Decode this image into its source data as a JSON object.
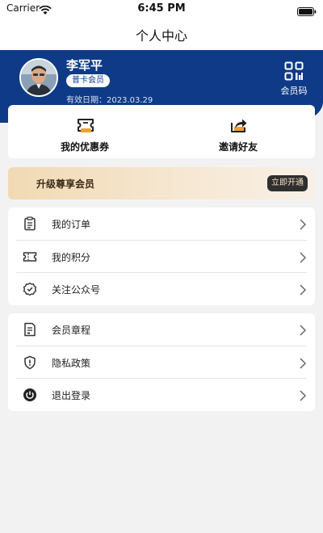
{
  "status_bar": {
    "carrier": "Carrier",
    "time": "6:45 PM",
    "icons": [
      "wifi-icon",
      "battery-icon"
    ]
  },
  "nav": {
    "title": "个人中心"
  },
  "profile": {
    "name": "李军平",
    "badge": "普卡会员",
    "valid_label": "有效日期：",
    "valid_date": "2023.03.29",
    "member_code_label": "会员码",
    "member_code_icon": "qrcode-icon"
  },
  "quick_actions": [
    {
      "label": "我的优惠券",
      "icon": "coupon-icon"
    },
    {
      "label": "邀请好友",
      "icon": "share-icon"
    }
  ],
  "upgrade": {
    "text": "升级尊享会员",
    "button": "立即开通"
  },
  "menu_group_1": [
    {
      "label": "我的订单",
      "icon": "clipboard-icon"
    },
    {
      "label": "我的积分",
      "icon": "ticket-icon"
    },
    {
      "label": "关注公众号",
      "icon": "badge-check-icon"
    }
  ],
  "menu_group_2": [
    {
      "label": "会员章程",
      "icon": "document-icon"
    },
    {
      "label": "隐私政策",
      "icon": "shield-icon"
    },
    {
      "label": "退出登录",
      "icon": "power-icon"
    }
  ],
  "colors": {
    "header_blue": "#0e3a87",
    "accent_orange": "#f0a030",
    "banner_gold": "#f1d9b4",
    "page_bg": "#f2f2f2"
  }
}
